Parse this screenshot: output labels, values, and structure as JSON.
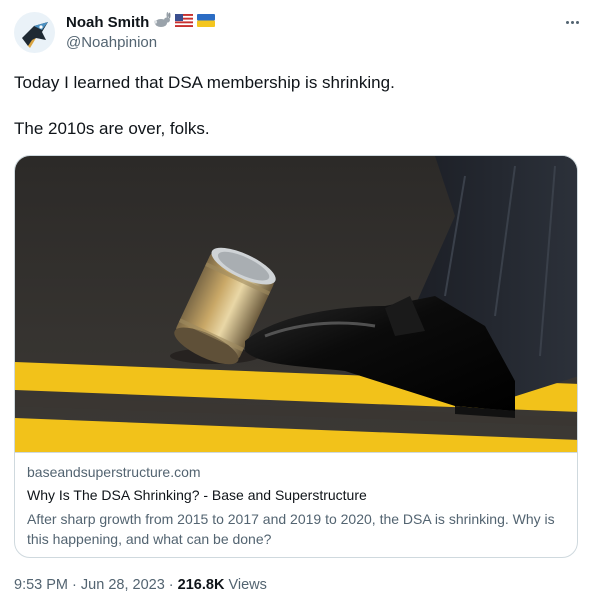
{
  "author": {
    "display_name": "Noah Smith",
    "handle": "@Noahpinion",
    "name_emojis": [
      "rabbit-icon",
      "us-flag-icon",
      "ukraine-flag-icon"
    ],
    "avatar_icon": "bird-avatar-icon"
  },
  "tweet": {
    "paragraphs": [
      "Today I learned that DSA membership is shrinking.",
      "The 2010s are over, folks."
    ]
  },
  "card": {
    "image_icon": "shoe-kicking-can-image",
    "domain": "baseandsuperstructure.com",
    "title": "Why Is The DSA Shrinking? - Base and Superstructure",
    "description": "After sharp growth from 2015 to 2017 and 2019 to 2020, the DSA is shrinking. Why is this happening, and what can be done?"
  },
  "meta": {
    "time": "9:53 PM",
    "separator": "·",
    "date": "Jun 28, 2023",
    "views_count": "216.8K",
    "views_label": "Views"
  },
  "colors": {
    "text_primary": "#0f1419",
    "text_secondary": "#536471",
    "border": "#cfd9de",
    "road_yellow": "#f2c21a"
  }
}
